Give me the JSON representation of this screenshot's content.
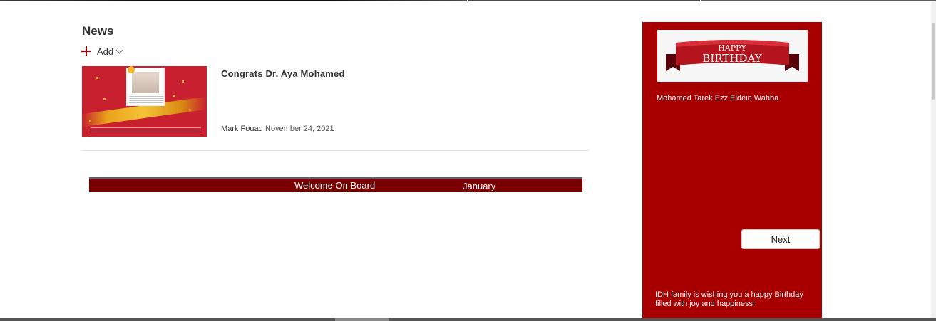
{
  "news": {
    "title": "News",
    "add_label": "Add",
    "items": [
      {
        "headline": "Congrats Dr. Aya Mohamed",
        "author": "Mark Fouad",
        "date": "November 24, 2021"
      }
    ]
  },
  "welcome": {
    "label": "Welcome On Board",
    "month": "January"
  },
  "birthday": {
    "banner_line1": "HAPPY",
    "banner_line2": "BIRTHDAY",
    "name": "Mohamed Tarek Ezz Eldein Wahba",
    "next_label": "Next",
    "message": "IDH family is wishing you a happy Birthday filled with joy and happiness!"
  },
  "colors": {
    "accent": "#a80000",
    "welcome_bar": "#7a0000"
  }
}
